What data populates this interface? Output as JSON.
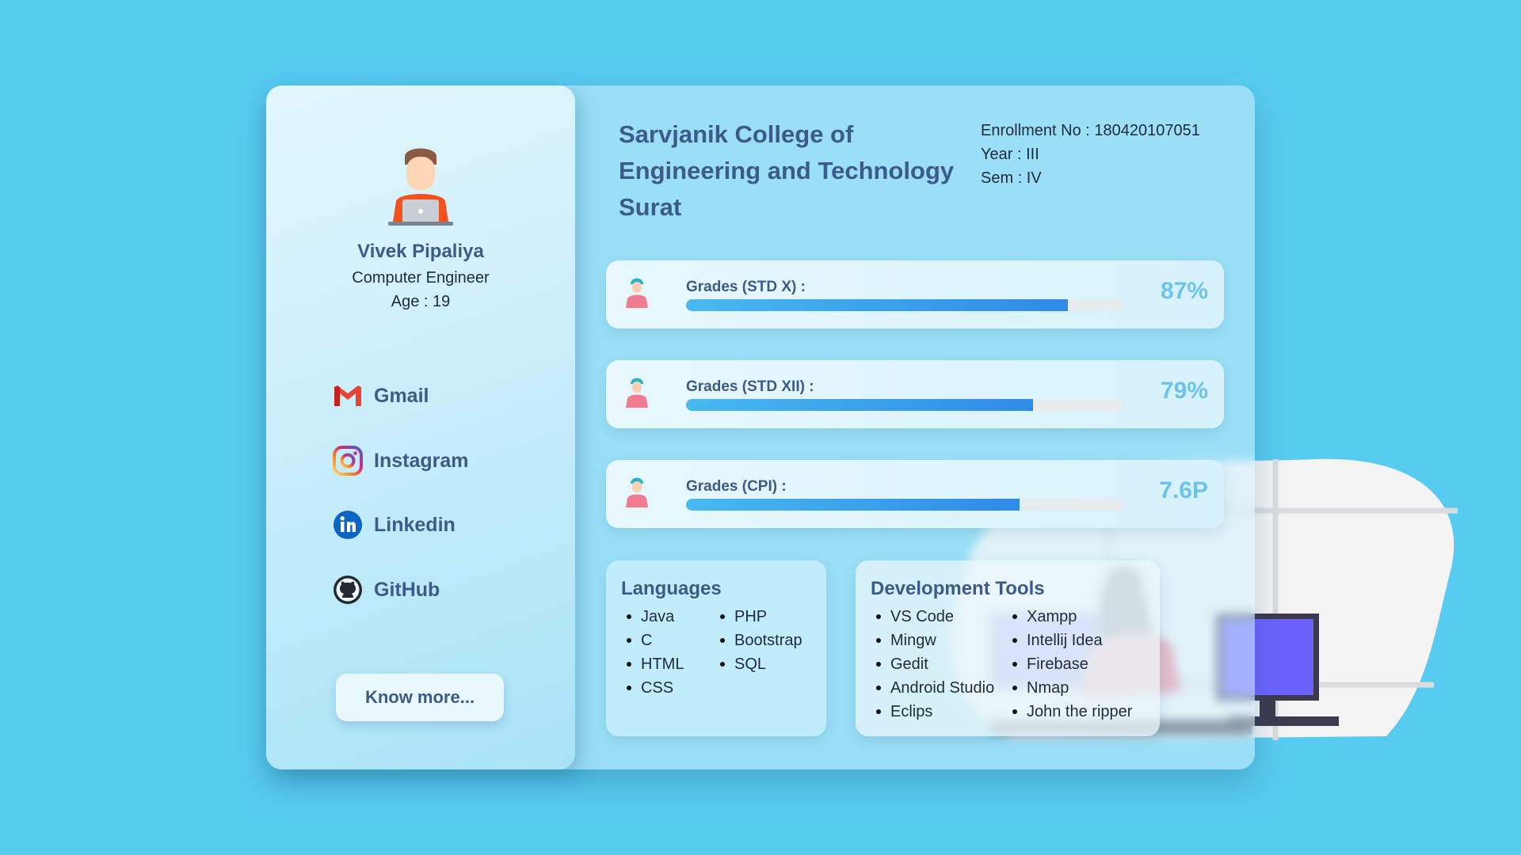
{
  "profile": {
    "name": "Vivek Pipaliya",
    "role": "Computer Engineer",
    "age": "Age : 19",
    "avatar_icon": "developer-avatar-icon",
    "socials": [
      {
        "label": "Gmail",
        "icon": "gmail-icon"
      },
      {
        "label": "Instagram",
        "icon": "instagram-icon"
      },
      {
        "label": "Linkedin",
        "icon": "linkedin-icon"
      },
      {
        "label": "GitHub",
        "icon": "github-icon"
      }
    ],
    "know_more_label": "Know more..."
  },
  "college": {
    "line1": "Sarvjanik College of",
    "line2": "Engineering and Technology",
    "line3": "Surat"
  },
  "meta": {
    "enrollment": "Enrollment No : 180420107051",
    "year": "Year : III",
    "sem": "Sem : IV"
  },
  "grades": [
    {
      "label": "Grades (STD X) :",
      "value": "87%",
      "progress": 0.87
    },
    {
      "label": "Grades (STD XII) :",
      "value": "79%",
      "progress": 0.79
    },
    {
      "label": "Grades (CPI) :",
      "value": "7.6P",
      "progress": 0.76
    }
  ],
  "languages": {
    "title": "Languages",
    "col1": [
      "Java",
      "C",
      "HTML",
      "CSS"
    ],
    "col2": [
      "PHP",
      "Bootstrap",
      "SQL"
    ]
  },
  "dev_tools": {
    "title": "Development Tools",
    "col1": [
      "VS Code",
      "Mingw",
      "Gedit",
      "Android Studio",
      "Eclips"
    ],
    "col2": [
      "Xampp",
      "Intellij Idea",
      "Firebase",
      "Nmap",
      "John the ripper"
    ]
  },
  "colors": {
    "background": "#58cbf1",
    "heading": "#3c5a8a",
    "grade_value": "#6ec3ee",
    "bar_fill": "#2f8be6"
  }
}
